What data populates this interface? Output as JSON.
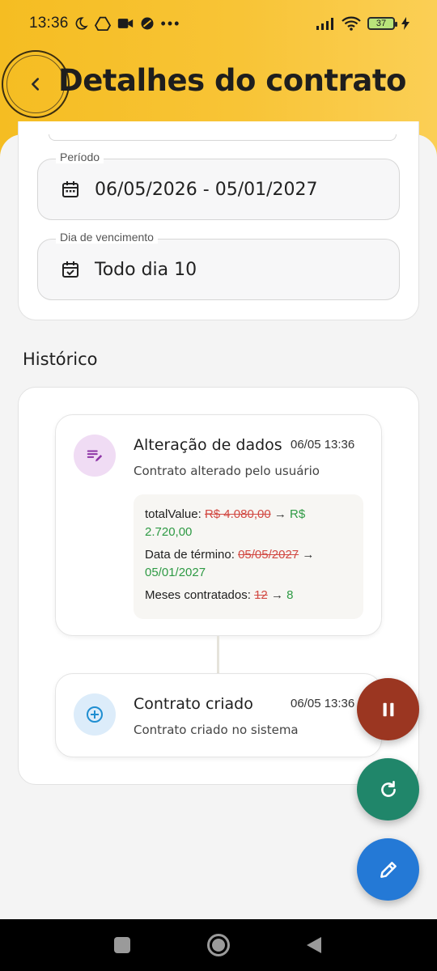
{
  "status_bar": {
    "time": "13:36",
    "battery": "37"
  },
  "header": {
    "title": "Detalhes do contrato"
  },
  "contract": {
    "periodo_label": "Período",
    "periodo_value": "06/05/2026 - 05/01/2027",
    "vencimento_label": "Dia de vencimento",
    "vencimento_value": "Todo dia 10"
  },
  "history": {
    "section_title": "Histórico",
    "events": [
      {
        "title": "Alteração de dados",
        "time": "06/05 13:36",
        "description": "Contrato alterado pelo usuário",
        "icon": "edit-note-icon",
        "changes": [
          {
            "field": "totalValue:",
            "old": "R$ 4.080,00",
            "arrow": "→",
            "new": "R$ 2.720,00"
          },
          {
            "field": "Data de término:",
            "old": "05/05/2027",
            "arrow": "→",
            "new": "05/01/2027"
          },
          {
            "field": "Meses contratados:",
            "old": "12",
            "arrow": "→",
            "new": "8"
          }
        ]
      },
      {
        "title": "Contrato criado",
        "time": "06/05 13:36",
        "description": "Contrato criado no sistema",
        "icon": "add-circle-icon"
      }
    ]
  },
  "colors": {
    "header_yellow": "#f5bd22",
    "pause_fab": "#9b3621",
    "refresh_fab": "#20866a",
    "edit_fab": "#2479d6",
    "old_value": "#d24a43",
    "new_value": "#2e9a44"
  },
  "fabs": [
    "pause-icon",
    "refresh-icon",
    "edit-icon"
  ]
}
